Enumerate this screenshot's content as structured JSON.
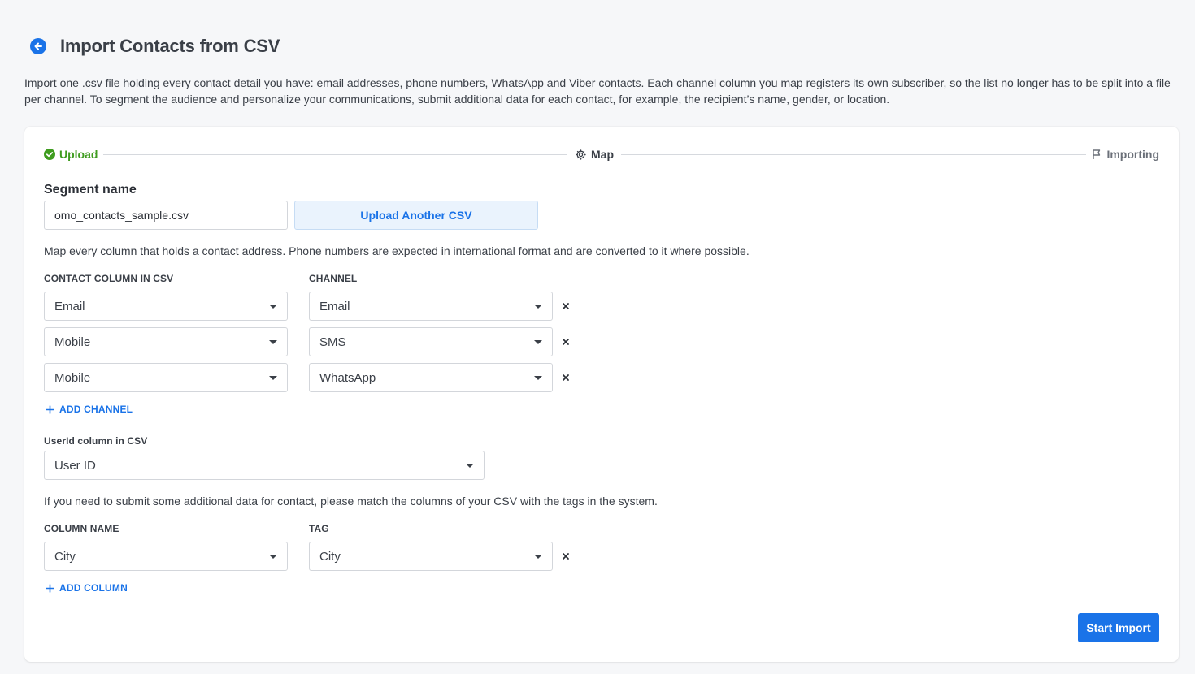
{
  "header": {
    "title": "Import Contacts from CSV"
  },
  "intro": {
    "line1": "Import one .csv file holding every contact detail you have: email addresses, phone numbers, WhatsApp and Viber contacts. Each channel column you map registers its own subscriber, so the list no longer has to be split into a file",
    "line2": "per channel. To segment the audience and personalize your communications, submit additional data for each contact, for example, the recipient’s name, gender, or location."
  },
  "stepper": {
    "steps": [
      {
        "label": "Upload",
        "state": "done",
        "icon": "check-circle-icon",
        "color": "#3f9c1f"
      },
      {
        "label": "Map",
        "state": "current",
        "icon": "gear-icon"
      },
      {
        "label": "Importing",
        "state": "pending",
        "icon": "flag-icon"
      }
    ]
  },
  "segment": {
    "label": "Segment name",
    "value": "omo_contacts_sample.csv",
    "upload_label": "Upload Another CSV"
  },
  "mapping": {
    "hint": "Map every column that holds a contact address. Phone numbers are expected in international format and are converted to it where possible.",
    "col_header": "CONTACT COLUMN IN CSV",
    "channel_header": "CHANNEL",
    "rows": [
      {
        "column": "Email",
        "channel": "Email"
      },
      {
        "column": "Mobile",
        "channel": "SMS"
      },
      {
        "column": "Mobile",
        "channel": "WhatsApp"
      }
    ],
    "add_label": "ADD CHANNEL"
  },
  "userid": {
    "label": "UserId column in CSV",
    "value": "User ID"
  },
  "extra": {
    "hint": "If you need to submit some additional data for contact, please match the columns of your CSV with the tags in the system.",
    "col_header": "COLUMN NAME",
    "tag_header": "TAG",
    "rows": [
      {
        "column": "City",
        "tag": "City"
      }
    ],
    "add_label": "ADD COLUMN"
  },
  "actions": {
    "start_label": "Start Import"
  },
  "colors": {
    "accent": "#1a73e8",
    "success": "#3f9c1f"
  }
}
